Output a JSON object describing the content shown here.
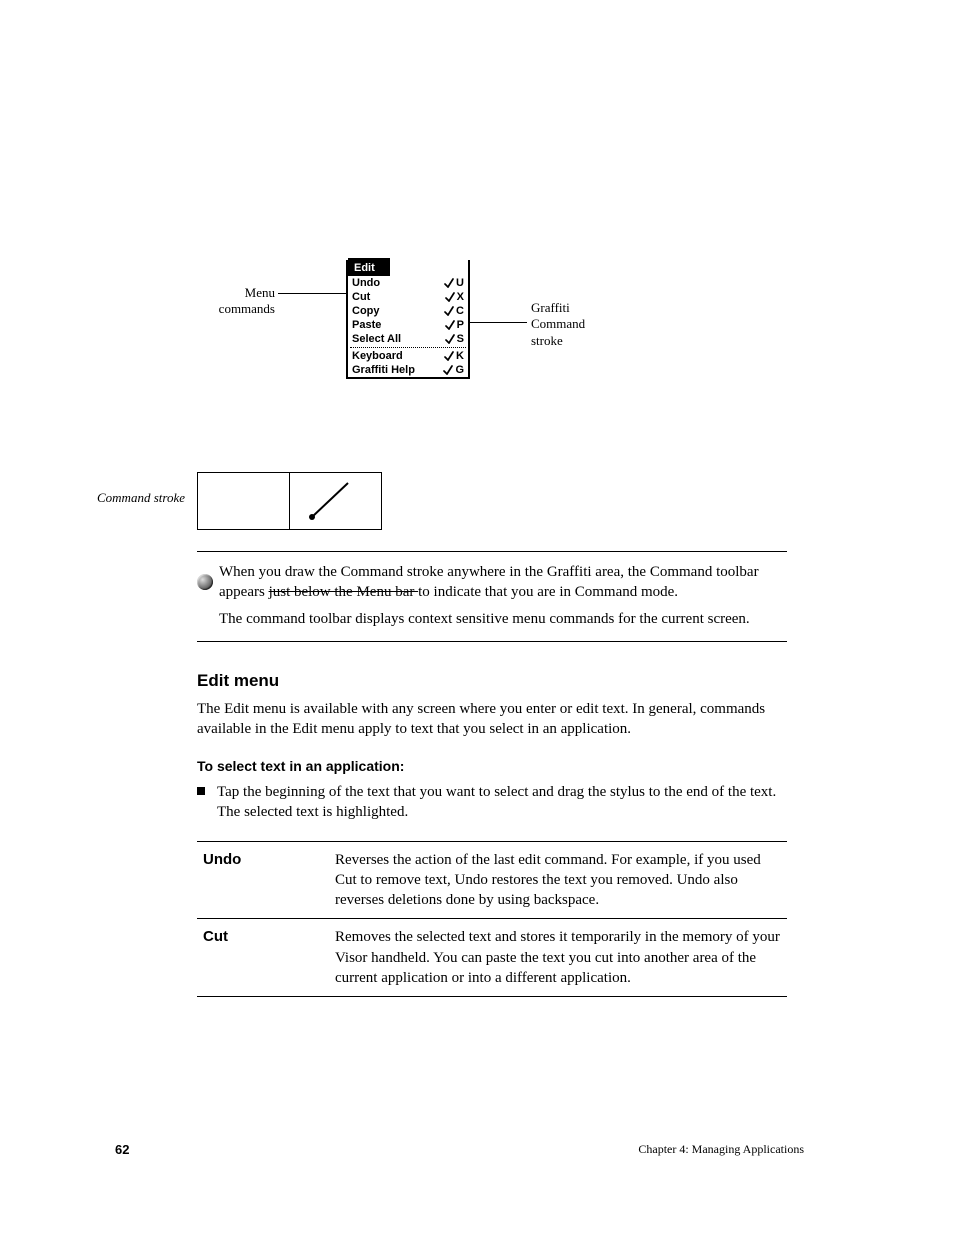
{
  "callouts": {
    "left_line1": "Menu",
    "left_line2": "commands",
    "right_line1": "Graffiti",
    "right_line2": "Command",
    "right_line3": "stroke"
  },
  "menu": {
    "title": "Edit",
    "items_top": [
      {
        "label": "Undo",
        "key": "U"
      },
      {
        "label": "Cut",
        "key": "X"
      },
      {
        "label": "Copy",
        "key": "C"
      },
      {
        "label": "Paste",
        "key": "P"
      },
      {
        "label": "Select All",
        "key": "S"
      }
    ],
    "items_bottom": [
      {
        "label": "Keyboard",
        "key": "K"
      },
      {
        "label": "Graffiti Help",
        "key": "G"
      }
    ]
  },
  "graffiti_label": "Command stroke",
  "tip_intro": "When you draw the Command stroke anywhere in the Graffiti area, the Command toolbar appears ",
  "tip_just_above": "just below the Menu bar ",
  "tip_rest": "to indicate that you are in Command mode.",
  "tip_extra": "The command toolbar displays context sensitive menu commands for the current screen.",
  "edit_heading": "Edit menu",
  "edit_intro": "The Edit menu is available with any screen where you enter or edit text. In general, commands available in the Edit menu apply to text that you select in an application.",
  "select_heading": "To select text in an application:",
  "select_step": "Tap the beginning of the text that you want to select and drag the stylus to the end of the text. The selected text is highlighted.",
  "table": [
    {
      "cmd": "Undo",
      "desc": "Reverses the action of the last edit command. For example, if you used Cut to remove text, Undo restores the text you removed. Undo also reverses deletions done by using backspace."
    },
    {
      "cmd": "Cut",
      "desc": "Removes the selected text and stores it temporarily in the memory of your Visor handheld. You can paste the text you cut into another area of the current application or into a different application."
    }
  ],
  "footer": {
    "page": "62",
    "chapter": "Chapter 4: Managing Applications"
  }
}
